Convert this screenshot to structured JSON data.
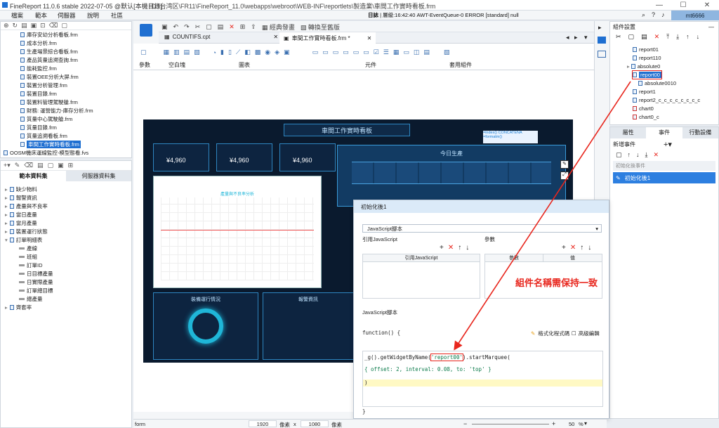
{
  "app": {
    "title": "FineReport 11.0.6 stable 2022-07-05 @默认[本機目錄]",
    "path": "D:\\台湾区\\FR11\\FineReport_11.0\\webapps\\webroot\\WEB-INF\\reportlets\\製造業\\車間工作實時看板.frm",
    "user": "mt6666",
    "log_label": "日誌",
    "log_text": "| 層級:16:42:40 AWT-EventQueue-0 ERROR [standard] null"
  },
  "menu": [
    "檔案",
    "範本",
    "伺服器",
    "說明",
    "社區"
  ],
  "file_tree": [
    "庫存安幼分析看板.frm",
    "成本分析.frm",
    "生產場景綜合看板.frm",
    "產品質量追溯查詢.frm",
    "能耗監控.frm",
    "裝置OEE分析大屏.frm",
    "裝置分析管理.frm",
    "裝置目錄.frm",
    "裝置料管理駕駛艙.frm",
    "財務: 運營能力-庫存分析.frm",
    "質量中心駕駛艙.frm",
    "質量目錄.frm",
    "質量追溯看板.frm",
    "車間工作實時看板.frm",
    "OOSM機床運線監控-模型態看.fvs"
  ],
  "dataset_tabs": [
    "範本資料集",
    "伺服器資料集"
  ],
  "dataset_tree": [
    "缺少物料",
    "報警資訊",
    "產量與不良率",
    "當日產量",
    "當月產量",
    "裝置運行狀態",
    "訂單明細表",
    "產線",
    "班組",
    "訂單ID",
    "日目標產量",
    "日實際產量",
    "訂單總目標",
    "總產量",
    "齊套率"
  ],
  "toolbar": {
    "trial": "經典發畫",
    "convert": "轉換至舊版"
  },
  "doc_tabs": [
    "COUNTIFS.cpt",
    "車間工作實時看板.frm *"
  ],
  "ribbon_groups": [
    "參數",
    "空白塊",
    "圖表",
    "元件",
    "套用組件"
  ],
  "dashboard": {
    "title": "車間工作實時看板",
    "kpi_values": [
      "¥4,960",
      "¥4,960",
      "¥4,960"
    ],
    "today_label": "今日生產",
    "gauge_label": "裝備運行情況",
    "alarm_label": "報警資訊",
    "chart_label": "產量與不良率分析",
    "formula_a": "=index()",
    "formula_b": "CONCATENA",
    "formula_c": "=formatm()"
  },
  "dialog": {
    "title": "初始化後1",
    "script_type": "JavaScript腳本",
    "ref_label": "引用JavaScript",
    "params_label": "參數",
    "ref_col": "引用JavaScript",
    "param_col": "參數",
    "value_col": "值",
    "js_label": "JavaScript腳本",
    "fn_open": "function() {",
    "format_btn": "格式化程式碼",
    "advanced_btn": "高級編輯",
    "code_line1_pre": "_g().getWidgetByName(",
    "code_line1_name": "'report00'",
    "code_line1_post": ").startMarquee(",
    "code_line2": "{ offset: 2, interval: 0.08, to: 'top' }",
    "code_line3": ")",
    "fn_close": "}"
  },
  "callout": "組件名稱需保持一致",
  "right_panel": {
    "title": "組件設置",
    "components": [
      "report01",
      "report110",
      "absolute0",
      "report00",
      "absolute0010",
      "report1",
      "report2_c_c_c_c_c_c_c_c",
      "chart0",
      "chart0_c"
    ],
    "tabs": [
      "屬性",
      "事件",
      "行動設備"
    ],
    "add_event": "新增事件",
    "section_label": "初始化後事件",
    "event_item": "初始化後1"
  },
  "status": {
    "mode": "form",
    "width": "1920",
    "px1": "像素",
    "x": "x",
    "height": "1080",
    "px2": "像素",
    "zoom": "50",
    "pct": "%"
  },
  "colors": {
    "accent": "#1f6fd1",
    "callout": "#e8261d",
    "dark_bg": "#0a1a2e"
  }
}
